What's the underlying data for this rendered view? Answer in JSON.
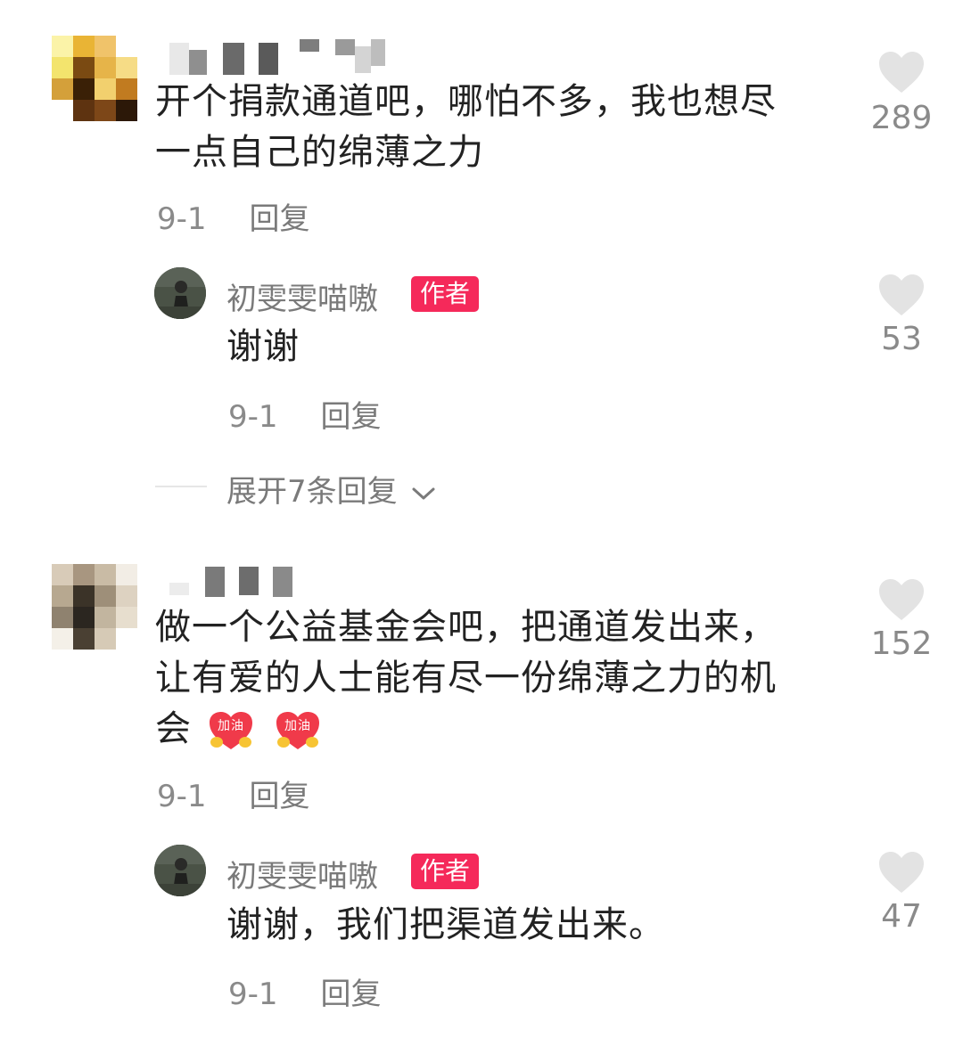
{
  "comments": [
    {
      "text": "开个捐款通道吧，哪怕不多，我也想尽一点自己的绵薄之力",
      "line1": "开个捐款通道吧，哪怕不多，我也想尽",
      "line2": "一点自己的绵薄之力",
      "date": "9-1",
      "reply_label": "回复",
      "likes": "289",
      "reply": {
        "author": "初雯雯喵嗷",
        "badge": "作者",
        "text": "谢谢",
        "date": "9-1",
        "reply_label": "回复",
        "likes": "53"
      },
      "expand_label": "展开7条回复"
    },
    {
      "line1": "做一个公益基金会吧，把通道发出来，",
      "line2": "让有爱的人士能有尽一份绵薄之力的机",
      "line3": "会",
      "stickers": [
        "加油",
        "加油"
      ],
      "date": "9-1",
      "reply_label": "回复",
      "likes": "152",
      "reply": {
        "author": "初雯雯喵嗷",
        "badge": "作者",
        "text": "谢谢，我们把渠道发出来。",
        "date": "9-1",
        "reply_label": "回复",
        "likes": "47"
      }
    }
  ],
  "icons": {
    "like": "heart-icon",
    "expand": "chevron-down-icon"
  },
  "colors": {
    "badge": "#f5295a",
    "heart": "#e3e3e3",
    "text": "#222222",
    "meta": "#8a8a8a"
  }
}
